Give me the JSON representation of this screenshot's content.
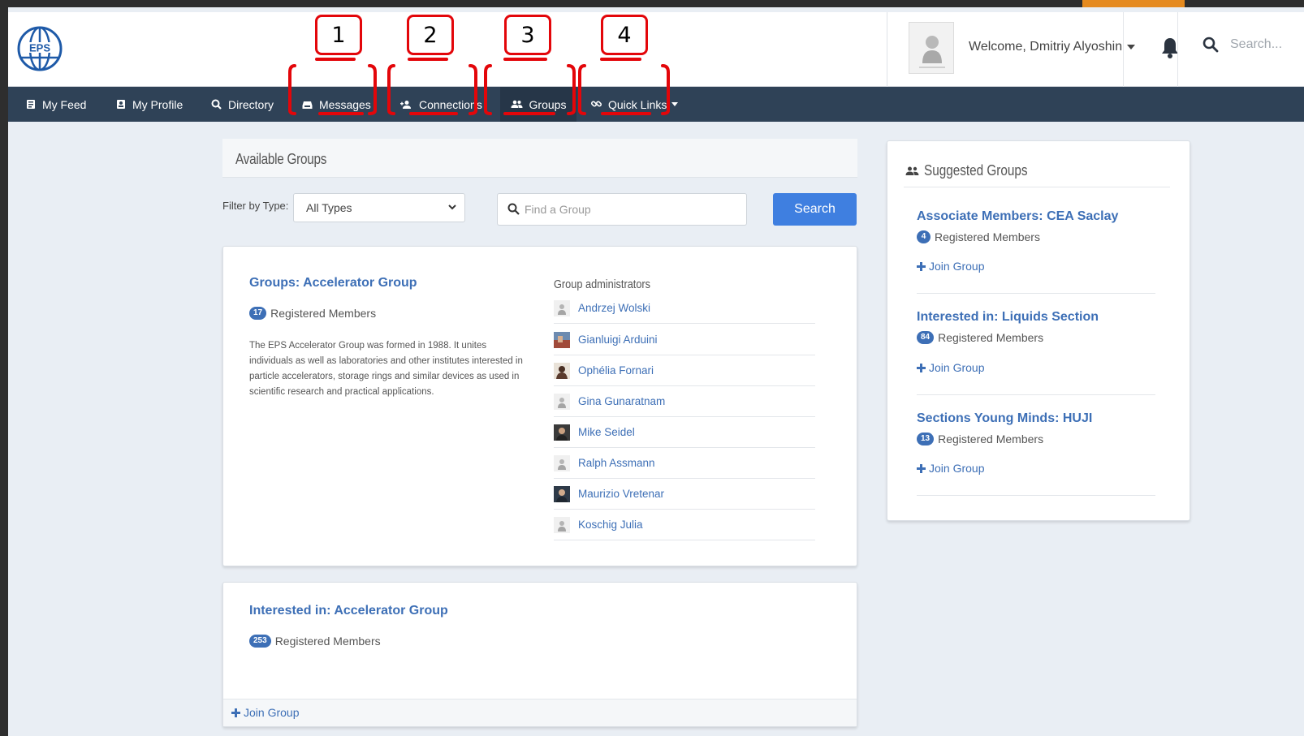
{
  "header": {
    "logo_text": "EPS",
    "welcome": "Welcome, Dmitriy Alyoshin",
    "search_placeholder": "Search..."
  },
  "nav": [
    {
      "label": "My Feed",
      "icon": "feed-icon"
    },
    {
      "label": "My Profile",
      "icon": "profile-icon"
    },
    {
      "label": "Directory",
      "icon": "search-icon"
    },
    {
      "label": "Messages",
      "icon": "inbox-icon"
    },
    {
      "label": "Connections",
      "icon": "connections-icon"
    },
    {
      "label": "Groups",
      "icon": "groups-icon",
      "active": true
    },
    {
      "label": "Quick Links",
      "icon": "link-icon",
      "has_dropdown": true
    }
  ],
  "annotations": [
    "1",
    "2",
    "3",
    "4"
  ],
  "main": {
    "section_title": "Available Groups",
    "filter_label": "Filter by Type:",
    "filter_value": "All Types",
    "find_placeholder": "Find a Group",
    "search_button": "Search",
    "groups": [
      {
        "title": "Groups: Accelerator Group",
        "count": "17",
        "members_label": "Registered Members",
        "description": "The EPS Accelerator Group was formed in 1988. It unites individuals as well as laboratories and other institutes interested in particle accelerators, storage rings and similar devices as used in scientific research and practical applications.",
        "admins_title": "Group administrators",
        "admins": [
          "Andrzej Wolski",
          "Gianluigi Arduini",
          "Ophélia Fornari",
          "Gina Gunaratnam",
          "Mike Seidel",
          "Ralph Assmann",
          "Maurizio Vretenar",
          "Koschig Julia"
        ]
      },
      {
        "title": "Interested in: Accelerator Group",
        "count": "253",
        "members_label": "Registered Members",
        "join_label": "Join Group"
      }
    ]
  },
  "suggested": {
    "title": "Suggested Groups",
    "items": [
      {
        "title": "Associate Members: CEA Saclay",
        "count": "4",
        "members_label": "Registered Members",
        "join_label": "Join Group"
      },
      {
        "title": "Interested in: Liquids Section",
        "count": "84",
        "members_label": "Registered Members",
        "join_label": "Join Group"
      },
      {
        "title": "Sections Young Minds: HUJI",
        "count": "13",
        "members_label": "Registered Members",
        "join_label": "Join Group"
      }
    ]
  },
  "colors": {
    "navbar": "#2f4257",
    "link": "#3d6fb6",
    "button": "#3f7fe0",
    "annotation": "#e3060a",
    "accent": "#e58a1f"
  }
}
